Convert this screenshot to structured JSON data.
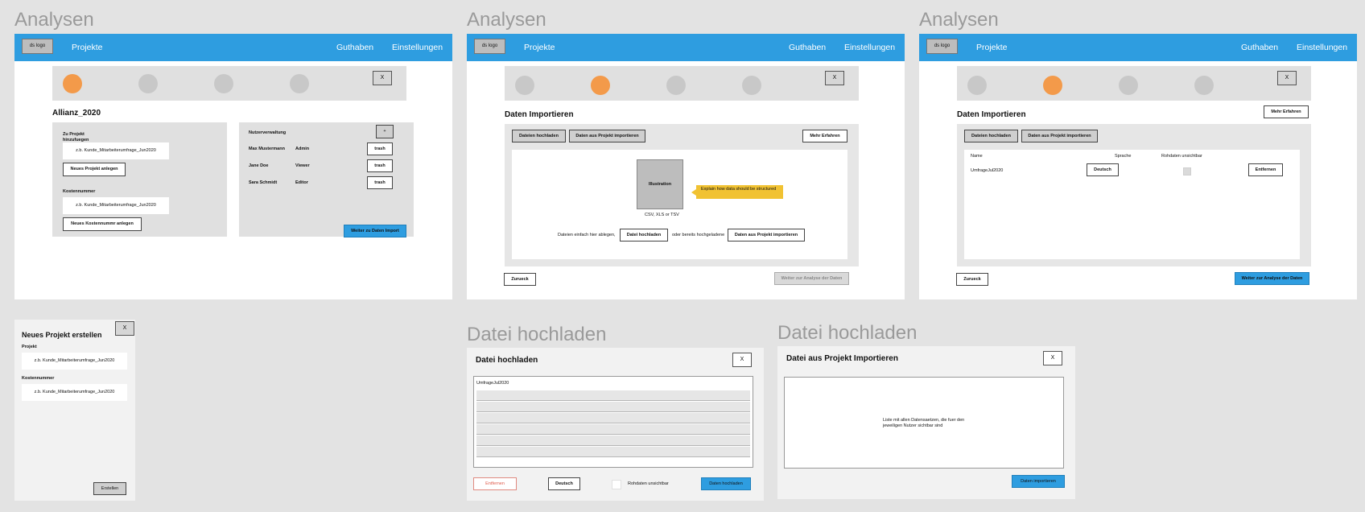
{
  "labels": {
    "analysen": "Analysen",
    "datei_hochladen": "Datei hochladen"
  },
  "nav": {
    "logo": "ds logo",
    "projekte": "Projekte",
    "guthaben": "Guthaben",
    "einstellungen": "Einstellungen"
  },
  "close": "X",
  "screen1": {
    "title": "Allianz_2020",
    "zu_projekt": "Zu Projekt hinzufuegen",
    "placeholder": "z.b. Kunde_Mitarbeiterumfrage_Jun2020",
    "neues_projekt": "Neues Projekt anlegen",
    "kostennummer": "Kostennummer",
    "neues_kosten": "Neues Kostennummr anlegen",
    "nutzerverwaltung": "Nutzerverwaltung",
    "plus": "+",
    "users": [
      {
        "name": "Max Mustermann",
        "role": "Admin",
        "action": "trash"
      },
      {
        "name": "Jane Doe",
        "role": "Viewer",
        "action": "trash"
      },
      {
        "name": "Sara Schmidt",
        "role": "Editor",
        "action": "trash"
      }
    ],
    "weiter": "Weiter zu Daten Import"
  },
  "screen2": {
    "title": "Daten Importieren",
    "tab_upload": "Dateien hochladen",
    "tab_import": "Daten aus Projekt importieren",
    "mehr": "Mehr Erfahren",
    "illustration": "Illustration",
    "tooltip": "Explain how data should be structured",
    "formats": "CSV, XLS or TSV",
    "drop_text": "Dateien einfach hier ablegen,",
    "btn_upload": "Datei hochladen",
    "or_text": "oder bereits hochgeladene",
    "btn_import": "Daten aus Projekt importieren",
    "zurueck": "Zurueck",
    "weiter": "Weiter zur Analyse der Daten"
  },
  "screen3": {
    "title": "Daten Importieren",
    "tab_upload": "Dateien hochladen",
    "tab_import": "Daten aus Projekt importieren",
    "mehr": "Mehr Erfahren",
    "col_name": "Name",
    "col_sprache": "Sprache",
    "col_rohdaten": "Rohdaten unsichtbar",
    "row_name": "UmfrageJul2020",
    "row_sprache": "Deutsch",
    "row_action": "Entfernen",
    "zurueck": "Zurueck",
    "weiter": "Weiter zur Analyse der Daten"
  },
  "dialog_new_project": {
    "title": "Neues Projekt erstellen",
    "projekt": "Projekt",
    "placeholder1": "z.b. Kunde_Mitarbeiterumfrage_Jun2020",
    "kostennummer": "Kostennummer",
    "placeholder2": "z.b. Kunde_Mitarbeiterumfrage_Jun2020",
    "erstellen": "Erstellen"
  },
  "dialog_upload": {
    "title": "Datei hochladen",
    "file": "UmfrageJul2020",
    "entfernen": "Entfernen",
    "sprache": "Deutsch",
    "rohdaten": "Rohdaten unsichtbar",
    "submit": "Daten hochladen"
  },
  "dialog_import": {
    "title": "Datei aus Projekt Importieren",
    "list_text": "Liste mit allen Datensaetzen, die fuer den jeweiligen Nutzer sichtbar sind",
    "submit": "Daten importieren"
  }
}
